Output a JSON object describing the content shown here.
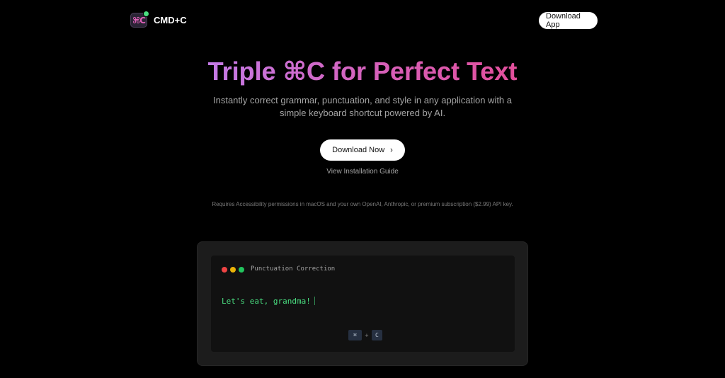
{
  "header": {
    "brand_name": "CMD+C",
    "logo_glyph": "⌘C",
    "download_app_label": "Download App"
  },
  "hero": {
    "title": "Triple ⌘C for Perfect Text",
    "subtitle": "Instantly correct grammar, punctuation, and style in any application with a simple keyboard shortcut powered by AI.",
    "download_now_label": "Download Now",
    "install_guide_label": "View Installation Guide",
    "requirements_note": "Requires Accessibility permissions in macOS and your own OpenAI, Anthropic, or premium subscription ($2.99) API key."
  },
  "demo": {
    "window_title": "Punctuation Correction",
    "text": "Let's eat, grandma!",
    "shortcut_keys": [
      "⌘",
      "C"
    ],
    "shortcut_separator": "+"
  },
  "icons": {
    "logo": "command-c-logo-icon",
    "status_dot": "green-status-dot-icon",
    "chevron": "chevron-right-icon"
  },
  "colors": {
    "background": "#000000",
    "title_gradient_start": "#c47ae6",
    "title_gradient_end": "#e24f9b",
    "demo_text": "#4ade80",
    "traffic_red": "#ef4444",
    "traffic_yellow": "#eab308",
    "traffic_green": "#22c55e"
  }
}
